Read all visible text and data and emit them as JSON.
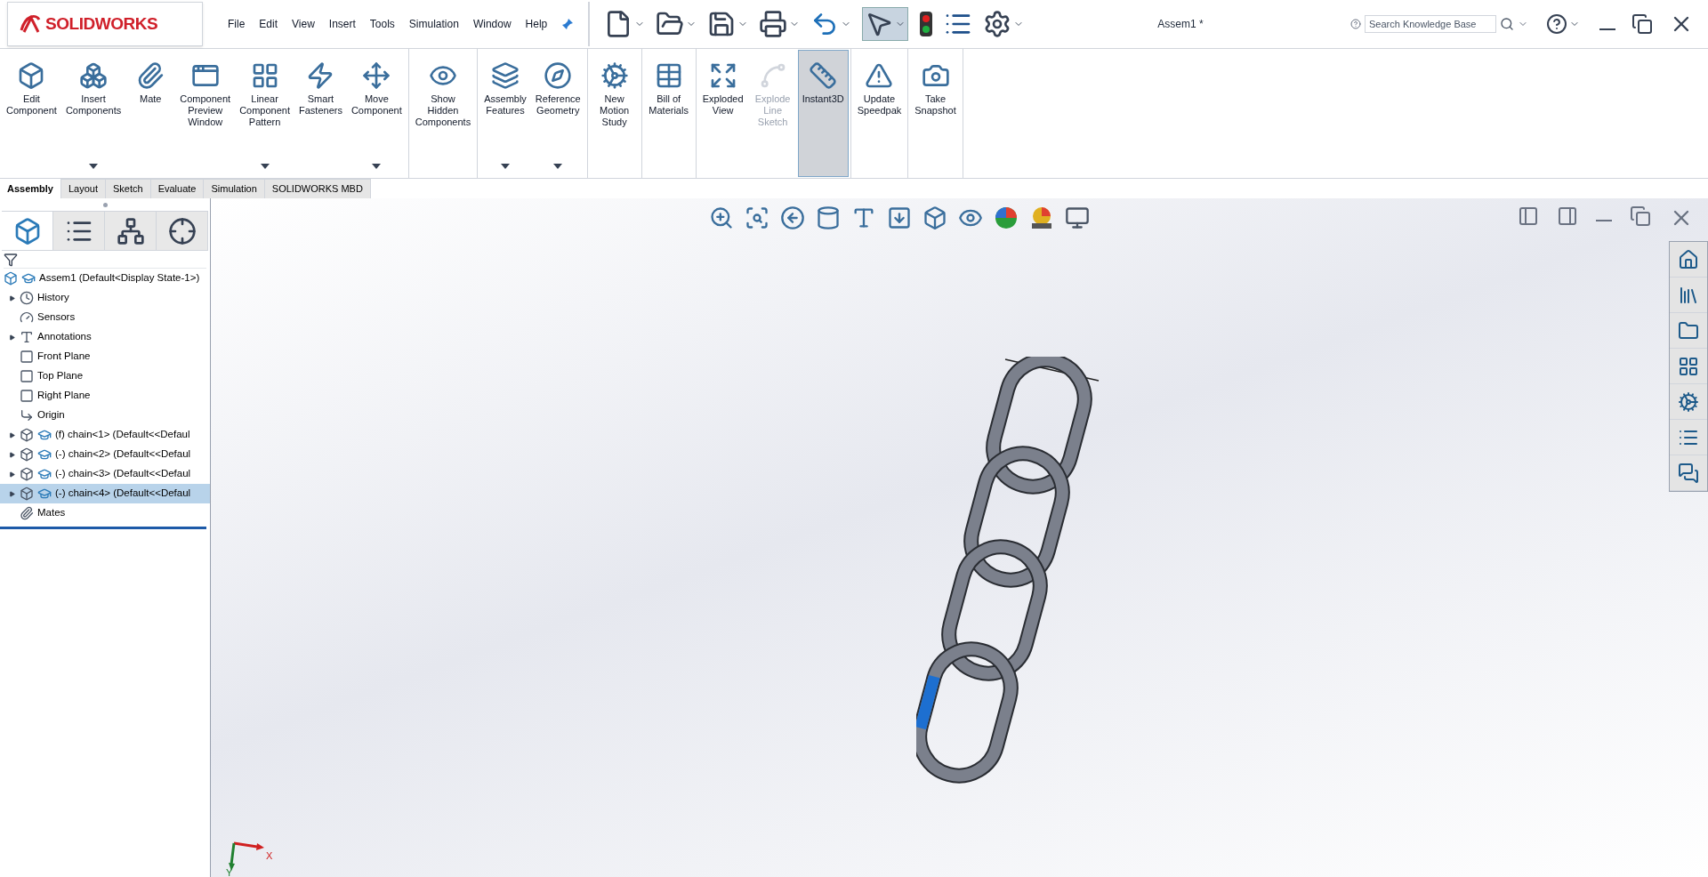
{
  "app": {
    "brand": "SOLIDWORKS",
    "title": "Assem1 *"
  },
  "menu": [
    "File",
    "Edit",
    "View",
    "Insert",
    "Tools",
    "Simulation",
    "Window",
    "Help"
  ],
  "search": {
    "placeholder": "Search Knowledge Base"
  },
  "ribbon_groups": [
    {
      "buttons": [
        {
          "lines": [
            "Edit",
            "Component"
          ],
          "has_menu": false,
          "selected": false,
          "disabled": false
        },
        {
          "lines": [
            "Insert",
            "Components"
          ],
          "has_menu": true,
          "selected": false,
          "disabled": false
        },
        {
          "lines": [
            "Mate"
          ],
          "has_menu": false,
          "selected": false,
          "disabled": false
        },
        {
          "lines": [
            "Component",
            "Preview",
            "Window"
          ],
          "has_menu": false,
          "selected": false,
          "disabled": false
        },
        {
          "lines": [
            "Linear",
            "Component",
            "Pattern"
          ],
          "has_menu": true,
          "selected": false,
          "disabled": false
        },
        {
          "lines": [
            "Smart",
            "Fasteners"
          ],
          "has_menu": false,
          "selected": false,
          "disabled": false
        },
        {
          "lines": [
            "Move",
            "Component"
          ],
          "has_menu": true,
          "selected": false,
          "disabled": false
        }
      ]
    },
    {
      "buttons": [
        {
          "lines": [
            "Show",
            "Hidden",
            "Components"
          ],
          "has_menu": false,
          "selected": false,
          "disabled": false
        }
      ]
    },
    {
      "buttons": [
        {
          "lines": [
            "Assembly",
            "Features"
          ],
          "has_menu": true,
          "selected": false,
          "disabled": false
        },
        {
          "lines": [
            "Reference",
            "Geometry"
          ],
          "has_menu": true,
          "selected": false,
          "disabled": false
        }
      ]
    },
    {
      "buttons": [
        {
          "lines": [
            "New",
            "Motion",
            "Study"
          ],
          "has_menu": false,
          "selected": false,
          "disabled": false
        }
      ]
    },
    {
      "buttons": [
        {
          "lines": [
            "Bill of",
            "Materials"
          ],
          "has_menu": false,
          "selected": false,
          "disabled": false
        }
      ]
    },
    {
      "buttons": [
        {
          "lines": [
            "Exploded",
            "View"
          ],
          "has_menu": false,
          "selected": false,
          "disabled": false
        },
        {
          "lines": [
            "Explode",
            "Line",
            "Sketch"
          ],
          "has_menu": false,
          "selected": false,
          "disabled": true
        },
        {
          "lines": [
            "Instant3D"
          ],
          "has_menu": false,
          "selected": true,
          "disabled": false
        }
      ]
    },
    {
      "buttons": [
        {
          "lines": [
            "Update",
            "Speedpak"
          ],
          "has_menu": false,
          "selected": false,
          "disabled": false
        }
      ]
    },
    {
      "buttons": [
        {
          "lines": [
            "Take",
            "Snapshot"
          ],
          "has_menu": false,
          "selected": false,
          "disabled": false
        }
      ]
    }
  ],
  "tabs": [
    {
      "label": "Assembly",
      "selected": true
    },
    {
      "label": "Layout",
      "selected": false
    },
    {
      "label": "Sketch",
      "selected": false
    },
    {
      "label": "Evaluate",
      "selected": false
    },
    {
      "label": "Simulation",
      "selected": false
    },
    {
      "label": "SOLIDWORKS MBD",
      "selected": false
    }
  ],
  "panel_tabs": [
    {
      "selected": true
    },
    {
      "selected": false
    },
    {
      "selected": false
    },
    {
      "selected": false
    }
  ],
  "tree": {
    "root": "Assem1  (Default<Display State-1>)",
    "items": [
      {
        "kind": "folder",
        "label": "History",
        "expandable": true,
        "selected": false
      },
      {
        "kind": "sensor",
        "label": "Sensors",
        "expandable": false,
        "selected": false
      },
      {
        "kind": "annotation",
        "label": "Annotations",
        "expandable": true,
        "selected": false
      },
      {
        "kind": "plane",
        "label": "Front Plane",
        "expandable": false,
        "selected": false
      },
      {
        "kind": "plane",
        "label": "Top Plane",
        "expandable": false,
        "selected": false
      },
      {
        "kind": "plane",
        "label": "Right Plane",
        "expandable": false,
        "selected": false
      },
      {
        "kind": "origin",
        "label": "Origin",
        "expandable": false,
        "selected": false
      },
      {
        "kind": "part",
        "label": "(f) chain<1> (Default<<Defaul",
        "expandable": true,
        "selected": false
      },
      {
        "kind": "part",
        "label": "(-) chain<2> (Default<<Defaul",
        "expandable": true,
        "selected": false
      },
      {
        "kind": "part",
        "label": "(-) chain<3> (Default<<Defaul",
        "expandable": true,
        "selected": false
      },
      {
        "kind": "part",
        "label": "(-) chain<4> (Default<<Defaul",
        "expandable": true,
        "selected": true
      },
      {
        "kind": "mates",
        "label": "Mates",
        "expandable": false,
        "selected": false
      }
    ]
  },
  "triad": {
    "x": "X",
    "y": "Y"
  }
}
